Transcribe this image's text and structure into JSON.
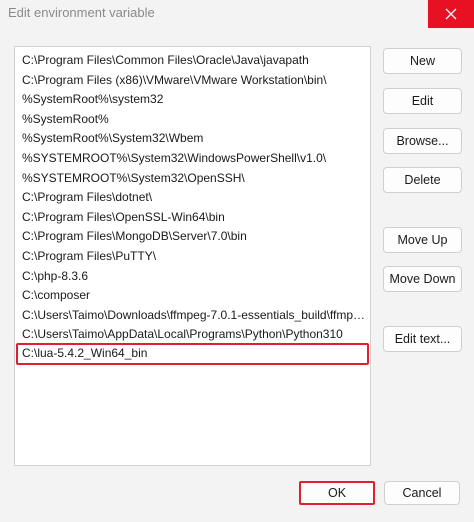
{
  "window": {
    "title": "Edit environment variable",
    "close_icon": "close-icon",
    "accent_close": "#e81123"
  },
  "list": {
    "items": [
      "C:\\Program Files\\Common Files\\Oracle\\Java\\javapath",
      "C:\\Program Files (x86)\\VMware\\VMware Workstation\\bin\\",
      "%SystemRoot%\\system32",
      "%SystemRoot%",
      "%SystemRoot%\\System32\\Wbem",
      "%SYSTEMROOT%\\System32\\WindowsPowerShell\\v1.0\\",
      "%SYSTEMROOT%\\System32\\OpenSSH\\",
      "C:\\Program Files\\dotnet\\",
      "C:\\Program Files\\OpenSSL-Win64\\bin",
      "C:\\Program Files\\MongoDB\\Server\\7.0\\bin",
      "C:\\Program Files\\PuTTY\\",
      "C:\\php-8.3.6",
      "C:\\composer",
      "C:\\Users\\Taimo\\Downloads\\ffmpeg-7.0.1-essentials_build\\ffmpeg...",
      "C:\\Users\\Taimo\\AppData\\Local\\Programs\\Python\\Python310",
      "C:\\lua-5.4.2_Win64_bin"
    ],
    "selected_index": 15,
    "highlight_color": "#e0202e"
  },
  "buttons": {
    "new": "New",
    "edit": "Edit",
    "browse": "Browse...",
    "delete": "Delete",
    "move_up": "Move Up",
    "move_down": "Move Down",
    "edit_text": "Edit text...",
    "ok": "OK",
    "cancel": "Cancel"
  }
}
